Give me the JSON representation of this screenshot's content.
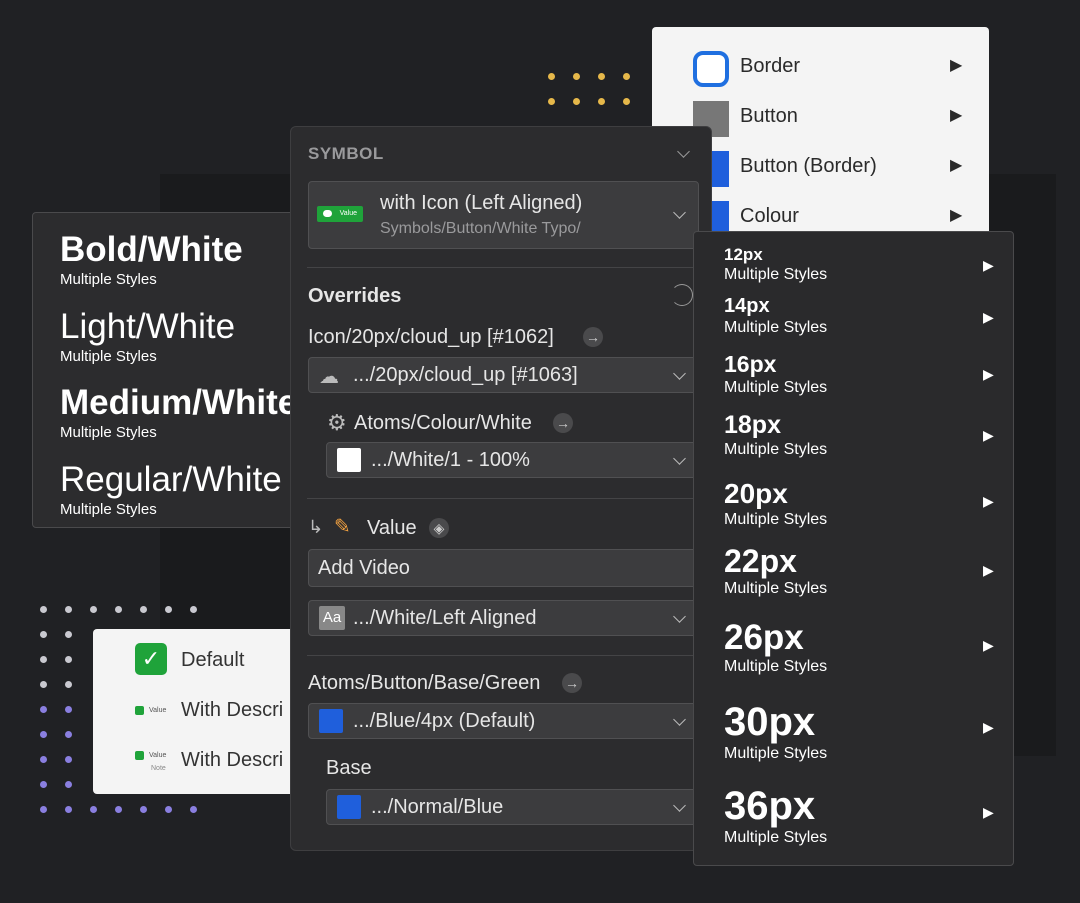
{
  "text_styles": [
    {
      "name": "Bold/White",
      "sub": "Multiple Styles"
    },
    {
      "name": "Light/White",
      "sub": "Multiple Styles"
    },
    {
      "name": "Medium/White",
      "sub": "Multiple Styles"
    },
    {
      "name": "Regular/White",
      "sub": "Multiple Styles"
    }
  ],
  "checkboxes": {
    "default_label": "Default",
    "desc1_label": "With Descri",
    "desc2_label": "With Descri",
    "tiny_value": "Value",
    "tiny_note": "Note"
  },
  "border_menu": {
    "items": [
      {
        "label": "Border",
        "arrow": "▶"
      },
      {
        "label": "Button",
        "arrow": "▶"
      },
      {
        "label": "Button (Border)",
        "arrow": "▶"
      },
      {
        "label": "Colour",
        "arrow": "▶"
      }
    ],
    "colors": {
      "border_ring": "#1f6fe0",
      "button_gray": "#777777",
      "blue": "#1f5fdc"
    }
  },
  "inspector": {
    "section_title": "SYMBOL",
    "symbol": {
      "thumb_text": "Value",
      "name": "with Icon (Left Aligned)",
      "path": "Symbols/Button/White Typo/"
    },
    "overrides_title": "Overrides",
    "icon_override": {
      "label": "Icon/20px/cloud_up [#1062]",
      "value": ".../20px/cloud_up [#1063]"
    },
    "colour_override": {
      "label": "Atoms/Colour/White",
      "value": ".../White/1 - 100%"
    },
    "value_override": {
      "label": "Value",
      "text_value": "Add Video",
      "style_value": ".../White/Left Aligned",
      "style_icon": "Aa"
    },
    "button_override": {
      "label": "Atoms/Button/Base/Green",
      "value": ".../Blue/4px (Default)"
    },
    "base_override": {
      "label": "Base",
      "value": ".../Normal/Blue"
    },
    "colors": {
      "accent_green": "#1fa33a",
      "blue_swatch": "#1f5fdc"
    }
  },
  "size_menu": {
    "items": [
      {
        "size": "12px",
        "sub": "Multiple Styles",
        "arrow": "▶"
      },
      {
        "size": "14px",
        "sub": "Multiple Styles",
        "arrow": "▶"
      },
      {
        "size": "16px",
        "sub": "Multiple Styles",
        "arrow": "▶"
      },
      {
        "size": "18px",
        "sub": "Multiple Styles",
        "arrow": "▶"
      },
      {
        "size": "20px",
        "sub": "Multiple Styles",
        "arrow": "▶"
      },
      {
        "size": "22px",
        "sub": "Multiple Styles",
        "arrow": "▶"
      },
      {
        "size": "26px",
        "sub": "Multiple Styles",
        "arrow": "▶"
      },
      {
        "size": "30px",
        "sub": "Multiple Styles",
        "arrow": "▶"
      },
      {
        "size": "36px",
        "sub": "Multiple Styles",
        "arrow": "▶"
      }
    ]
  }
}
